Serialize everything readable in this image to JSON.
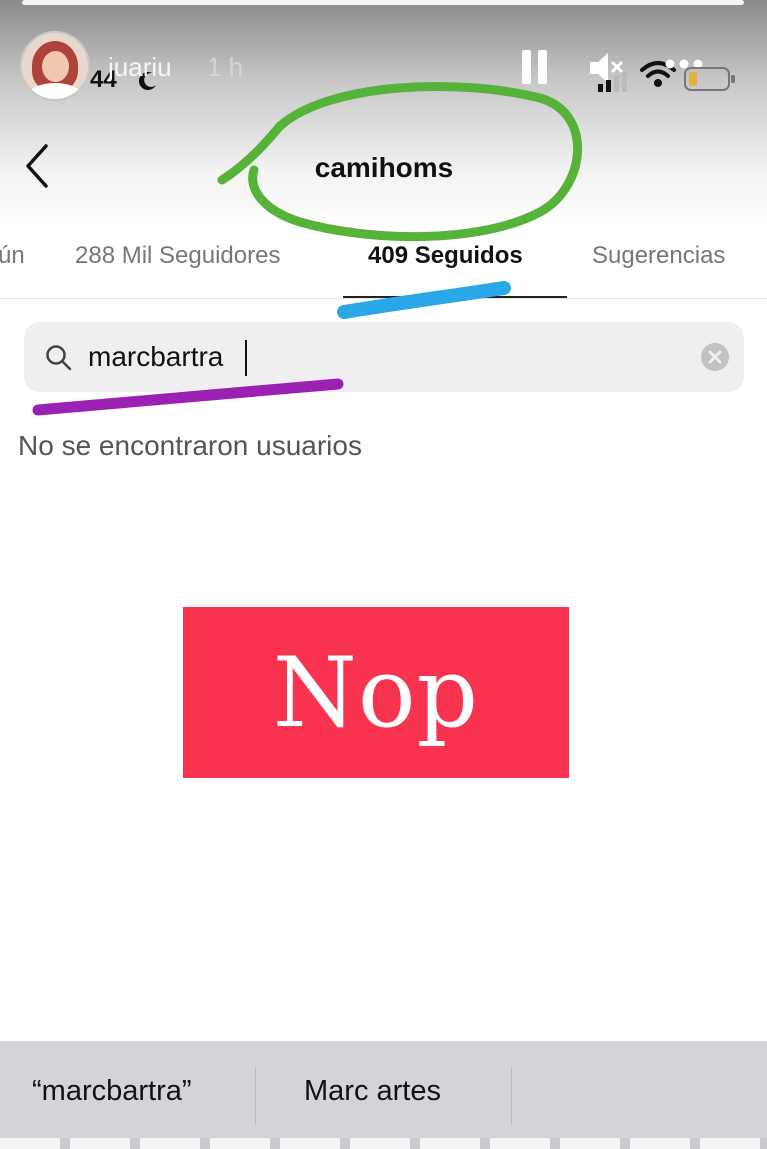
{
  "story": {
    "username": "juariu",
    "age": "1 h",
    "clock": "44"
  },
  "header": {
    "title": "camihoms"
  },
  "tabs": [
    {
      "label": "ún"
    },
    {
      "label": "288 Mil Seguidores"
    },
    {
      "label": "409 Seguidos",
      "active": true
    },
    {
      "label": "Sugerencias"
    }
  ],
  "search": {
    "value": "marcbartra"
  },
  "results": {
    "empty_message": "No se encontraron usuarios"
  },
  "overlay": {
    "label": "Nop",
    "color": "#f7334f"
  },
  "keyboard_suggestions": [
    {
      "label": "“marcbartra”"
    },
    {
      "label": "Marc artes"
    }
  ],
  "colors": {
    "green_annotation": "#56b33a",
    "blue_annotation": "#2aa7e6",
    "purple_annotation": "#9b21b2"
  }
}
